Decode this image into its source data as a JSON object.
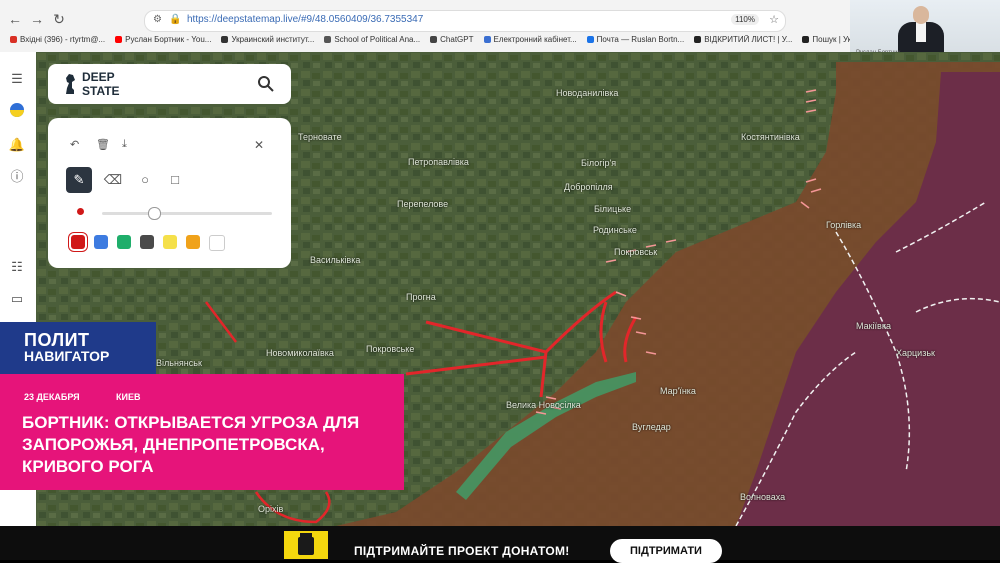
{
  "browser": {
    "url": "https://deepstatemap.live/#9/48.0560409/36.7355347",
    "zoom": "110%",
    "bookmarks": [
      {
        "label": "Вхідні (396) - rtyrtm@...",
        "color": "#d93025"
      },
      {
        "label": "Руслан Бортник - You...",
        "color": "#ff0000"
      },
      {
        "label": "Украинский институт...",
        "color": "#333333"
      },
      {
        "label": "School of Political Ana...",
        "color": "#555555"
      },
      {
        "label": "ChatGPT",
        "color": "#444444"
      },
      {
        "label": "Електронний кабінет...",
        "color": "#3b6fd1"
      },
      {
        "label": "Почта — Ruslan Bortn...",
        "color": "#1a73e8"
      },
      {
        "label": "ВІДКРИТИЙ ЛИСТ! | У...",
        "color": "#222222"
      },
      {
        "label": "Пошук | Украї",
        "color": "#222222"
      }
    ]
  },
  "webcam": {
    "label": "Руслан Бортник"
  },
  "map": {
    "towns": [
      {
        "name": "Новоданилівка"
      },
      {
        "name": "Терноватe"
      },
      {
        "name": "Петропавлівка"
      },
      {
        "name": "Білогір'я"
      },
      {
        "name": "Костянтинівка"
      },
      {
        "name": "Добропілля"
      },
      {
        "name": "Білицьке"
      },
      {
        "name": "Перепелове"
      },
      {
        "name": "Родинське"
      },
      {
        "name": "Покровськ"
      },
      {
        "name": "Горлівка"
      },
      {
        "name": "Васильківка"
      },
      {
        "name": "Прогна"
      },
      {
        "name": "Новомиколаївка"
      },
      {
        "name": "Покровське"
      },
      {
        "name": "Вільнянськ"
      },
      {
        "name": "Велика Новосілка"
      },
      {
        "name": "Вугледар"
      },
      {
        "name": "Макіївка"
      },
      {
        "name": "Оріхів"
      },
      {
        "name": "Харцизьк"
      },
      {
        "name": "Мар'їнка"
      },
      {
        "name": "Волноваха"
      }
    ]
  },
  "logo": {
    "line1": "DEEP",
    "line2": "STATE"
  },
  "draw_panel": {
    "swatches": [
      "#d01818",
      "#3d7be0",
      "#1fae6b",
      "#4a4a4a",
      "#f5e04a",
      "#f0a21a",
      "#ffffff"
    ],
    "close_glyph": "✕"
  },
  "news": {
    "logo_line1": "ПОЛИТ",
    "logo_line2": "НАВИГАТОР",
    "date": "23 ДЕКАБРЯ",
    "city": "КИЕВ",
    "headline": "БОРТНИК: ОТКРЫВАЕТСЯ УГРОЗА ДЛЯ ЗАПОРОЖЬЯ, ДНЕПРОПЕТРОВСКА, КРИВОГО РОГА"
  },
  "donate": {
    "text": "ПІДТРИМАЙТЕ ПРОЕКТ ДОНАТОМ!",
    "button": "ПІДТРИМАТИ"
  }
}
